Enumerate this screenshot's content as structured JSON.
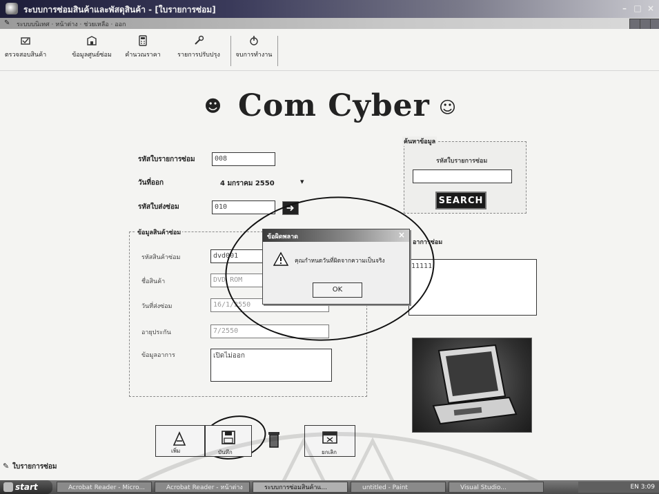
{
  "window": {
    "title": "ระบบการซ่อมสินค้าและพัสดุสินค้า - [ใบรายการซ่อม]"
  },
  "menubar": {
    "items": "ระบบบนิเทศ · หน้าต่าง · ช่วยเหลือ · ออก"
  },
  "toolbar": {
    "items": [
      {
        "label": "ตรวจสอบสินค้า",
        "icon": "box-check-icon"
      },
      {
        "label": "ข้อมูลศูนย์ซ่อม",
        "icon": "building-icon"
      },
      {
        "label": "คำนวณราคา",
        "icon": "calculator-icon"
      },
      {
        "label": "รายการปรับปรุง",
        "icon": "wrench-icon"
      },
      {
        "label": "จบการทำงาน",
        "icon": "exit-icon"
      }
    ]
  },
  "logo": {
    "text": "Com Cyber"
  },
  "form": {
    "repair_id_label": "รหัสใบรายการซ่อม",
    "repair_id_value": "008",
    "date_label": "วันที่ออก",
    "date_value": "4  มกราคม  2550",
    "send_id_label": "รหัสใบส่งซ่อม",
    "send_id_value": "010"
  },
  "product_group": {
    "title": "ข้อมูลสินค้าซ่อม",
    "fields": [
      {
        "label": "รหัสสินค้าซ่อม",
        "value": "dvd001"
      },
      {
        "label": "ชื่อสินค้า",
        "value": "DVD ROM"
      },
      {
        "label": "วันที่ส่งซ่อม",
        "value": "16/1/2550"
      },
      {
        "label": "อายุประกัน",
        "value": "7/2550"
      },
      {
        "label": "ข้อมูลอาการ",
        "value": "เปิดไม่ออก"
      }
    ]
  },
  "repair_panel": {
    "title": "อาการซ่อม",
    "value": "11111"
  },
  "search": {
    "title": "ค้นหาข้อมูล",
    "label": "รหัสใบรายการซ่อม",
    "input": "",
    "button": "SEARCH"
  },
  "dialog": {
    "title": "ข้อผิดพลาด",
    "message": "คุณกำหนดวันที่ผิดจากความเป็นจริง",
    "ok": "OK",
    "close": "×"
  },
  "bottom_buttons": [
    {
      "label": "เพิ่ม",
      "icon": "add-icon"
    },
    {
      "label": "บันทึก",
      "icon": "save-icon"
    },
    {
      "label": "ลบ",
      "icon": "delete-icon"
    },
    {
      "label": "ยกเลิก",
      "icon": "cancel-icon"
    }
  ],
  "status": {
    "text": "ใบรายการซ่อม"
  },
  "taskbar": {
    "start": "start",
    "tasks": [
      "Acrobat Reader - Micro...",
      "Acrobat Reader - หน้าต่าง",
      "ระบบการซ่อมสินค้าแ...",
      "untitled - Paint",
      "Visual Studio..."
    ],
    "tray": "EN  3:09"
  }
}
